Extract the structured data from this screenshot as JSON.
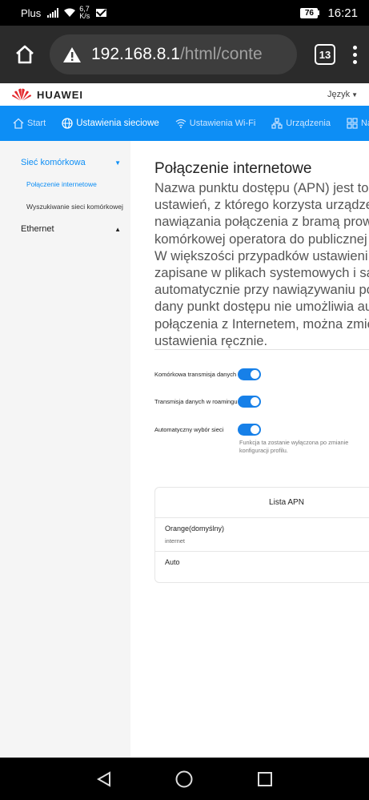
{
  "statusbar": {
    "carrier": "Plus",
    "speed_value": "6,7",
    "speed_unit": "K/s",
    "battery": "76",
    "time": "16:21"
  },
  "browser": {
    "url_host": "192.168.8.1",
    "url_path": "/html/conte",
    "tab_count": "13"
  },
  "header": {
    "logo_text": "HUAWEI",
    "language_label": "Język"
  },
  "nav": {
    "items": [
      {
        "label": "Start",
        "icon": "home-icon"
      },
      {
        "label": "Ustawienia sieciowe",
        "icon": "globe-icon"
      },
      {
        "label": "Ustawienia Wi-Fi",
        "icon": "wifi-icon"
      },
      {
        "label": "Urządzenia",
        "icon": "devices-icon"
      },
      {
        "label": "Narzędzia",
        "icon": "tools-icon"
      }
    ]
  },
  "sidebar": {
    "group1": "Sieć komórkowa",
    "sub1": "Połączenie internetowe",
    "sub2": "Wyszukiwanie sieci komórkowej",
    "group2": "Ethernet"
  },
  "main": {
    "title": "Połączenie internetowe",
    "description_lines": [
      "Nazwa punktu dostępu (APN) jest to",
      "ustawień, z którego korzysta urządze",
      "nawiązania połączenia z bramą prow",
      "komórkowej operatora do publicznej",
      "W większości przypadków ustawieni",
      "zapisane w plikach systemowych i sa",
      "automatycznie przy nawiązywaniu po",
      "dany punkt dostępu nie umożliwia au",
      "połączenia z Internetem, można zmie",
      "ustawienia ręcznie."
    ],
    "toggles": [
      {
        "label": "Komórkowa transmisja danych",
        "on": true
      },
      {
        "label": "Transmisja danych w roamingu",
        "on": true
      },
      {
        "label": "Automatyczny wybór sieci",
        "on": true
      }
    ],
    "note": "Funkcja ta zostanie wyłączona po zmianie konfiguracji profilu.",
    "apn_list": {
      "header": "Lista APN",
      "items": [
        {
          "name": "Orange(domyślny)",
          "sub": "internet"
        },
        {
          "name": "Auto",
          "sub": ""
        }
      ]
    }
  },
  "colors": {
    "nav_blue": "#0d8ef5",
    "toggle_blue": "#1780e8",
    "huawei_red": "#e3262b"
  }
}
